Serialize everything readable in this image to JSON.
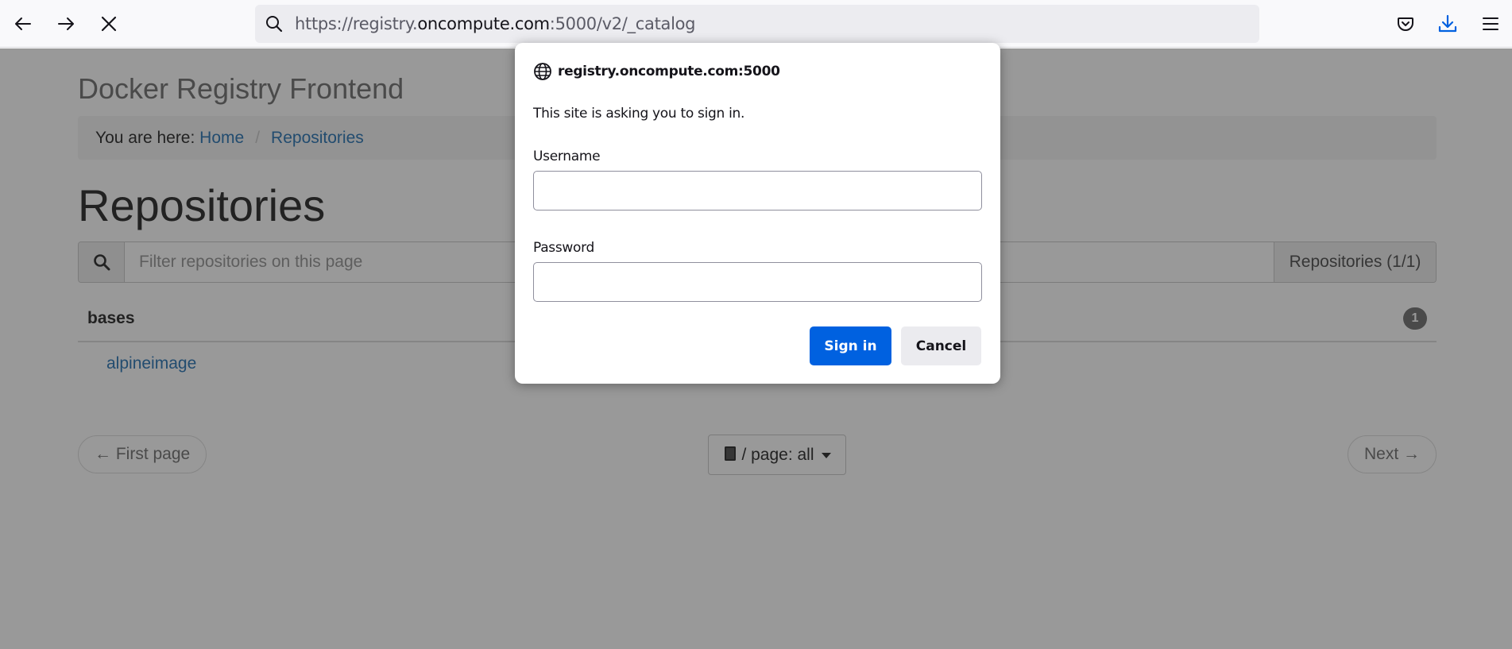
{
  "browser": {
    "url_prefix": "https://registry.",
    "url_host": "oncompute.com",
    "url_suffix": ":5000/v2/_catalog",
    "icons": {
      "back": "arrow-left-icon",
      "forward": "arrow-right-icon",
      "stop": "close-icon",
      "search": "search-icon",
      "pocket": "pocket-icon",
      "downloads": "download-icon",
      "menu": "hamburger-menu-icon"
    },
    "accent_color": "#0061e0"
  },
  "page": {
    "brand": "Docker Registry Frontend",
    "breadcrumb": {
      "prefix": "You are here:",
      "items": [
        "Home",
        "Repositories"
      ]
    },
    "title": "Repositories",
    "filter": {
      "placeholder": "Filter repositories on this page",
      "count_label": "Repositories (1/1)"
    },
    "groups": [
      {
        "name": "bases",
        "count": "1",
        "repos": [
          "alpineimage"
        ]
      }
    ],
    "pagination": {
      "first_label": "← First page",
      "per_page_label": "/ page: all",
      "next_label": "Next →"
    },
    "link_color": "#337ab7"
  },
  "dialog": {
    "host": "registry.oncompute.com:5000",
    "message": "This site is asking you to sign in.",
    "username_label": "Username",
    "username_value": "",
    "password_label": "Password",
    "password_value": "",
    "signin_label": "Sign in",
    "cancel_label": "Cancel"
  }
}
